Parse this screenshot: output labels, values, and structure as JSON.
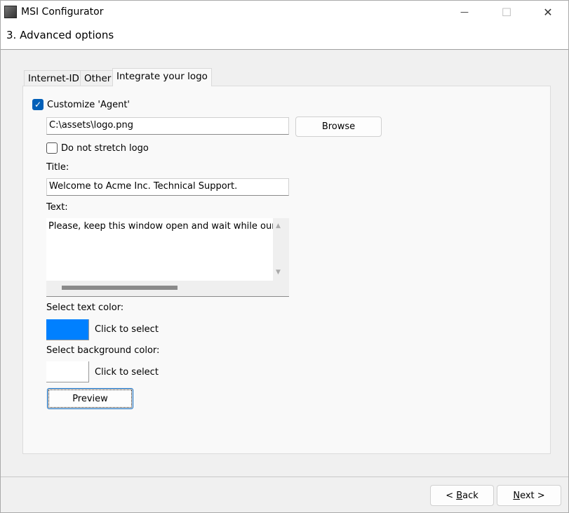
{
  "window": {
    "title": "MSI Configurator",
    "step_title": "3. Advanced options",
    "app_icon": "installer-icon",
    "controls": {
      "minimize": "—",
      "maximize": "☐",
      "close": "✕"
    }
  },
  "tabs": [
    {
      "label": "Internet-ID",
      "active": false
    },
    {
      "label": "Other",
      "active": false
    },
    {
      "label": "Integrate your logo",
      "active": true
    }
  ],
  "logo": {
    "customize_label": "Customize 'Agent'",
    "customize_checked": true,
    "path_value": "C:\\assets\\logo.png",
    "browse_label": "Browse",
    "no_stretch_label": "Do not stretch logo",
    "no_stretch_checked": false,
    "title_label": "Title:",
    "title_value": "Welcome to Acme Inc. Technical Support.",
    "text_label": "Text:",
    "text_value": "Please, keep this window open and wait while our support",
    "text_color_label": "Select text color:",
    "text_color": "#0080ff",
    "text_color_action": "Click to select",
    "bg_color_label": "Select background color:",
    "bg_color": "#ffffff",
    "bg_color_action": "Click to select",
    "preview_label": "Preview"
  },
  "footer": {
    "back": {
      "prefix": "< ",
      "accel": "B",
      "rest": "ack"
    },
    "next": {
      "accel": "N",
      "rest": "ext >"
    }
  }
}
